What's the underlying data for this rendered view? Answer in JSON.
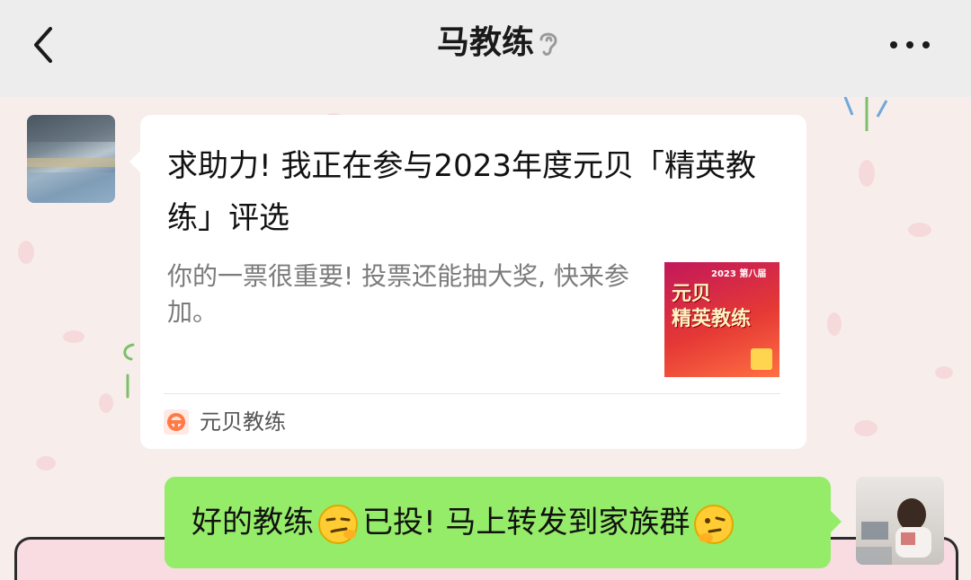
{
  "header": {
    "title": "马教练",
    "back_icon": "chevron-left-icon",
    "muted_icon": "ear-icon",
    "more_icon": "more-dots-icon"
  },
  "messages": [
    {
      "type": "link-card",
      "sender": "contact",
      "title": "求助力! 我正在参与2023年度元贝「精英教练」评选",
      "description": "你的一票很重要! 投票还能抽大奖, 快来参加。",
      "thumbnail": {
        "line1": "元贝",
        "line2": "精英教练",
        "badge": "2023 第八届"
      },
      "source": "元贝教练"
    },
    {
      "type": "text",
      "sender": "me",
      "part1": "好的教练",
      "part2": "已投! 马上转发到家族群",
      "emoji1": "smirk-emoji",
      "emoji2": "thinking-emoji"
    }
  ],
  "colors": {
    "header_bg": "#ededed",
    "my_bubble": "#95ec69",
    "card_bg": "#ffffff",
    "wallpaper": "#f7eeeb"
  }
}
